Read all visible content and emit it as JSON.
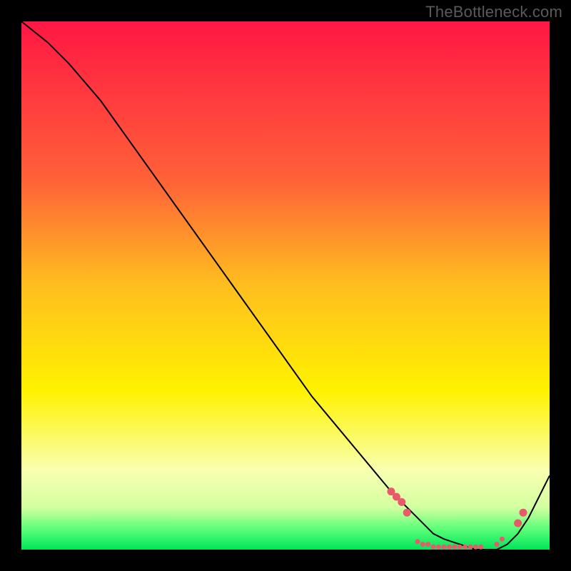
{
  "watermark": "TheBottleneck.com",
  "chart_data": {
    "type": "line",
    "title": "",
    "xlabel": "",
    "ylabel": "",
    "xlim": [
      0,
      100
    ],
    "ylim": [
      0,
      100
    ],
    "grid": false,
    "legend": false,
    "background_gradient_stops": [
      {
        "offset": 0,
        "color": "#ff1744"
      },
      {
        "offset": 30,
        "color": "#ff6138"
      },
      {
        "offset": 50,
        "color": "#ffbe1f"
      },
      {
        "offset": 70,
        "color": "#fff200"
      },
      {
        "offset": 85,
        "color": "#f9ffb0"
      },
      {
        "offset": 92,
        "color": "#d3ffa0"
      },
      {
        "offset": 96,
        "color": "#5eff7a"
      },
      {
        "offset": 100,
        "color": "#00e55a"
      }
    ],
    "series": [
      {
        "name": "curve",
        "stroke": "#000000",
        "x": [
          0,
          5,
          9,
          15,
          20,
          25,
          30,
          35,
          40,
          45,
          50,
          55,
          60,
          65,
          70,
          72,
          75,
          78,
          80,
          83,
          86,
          88,
          90,
          92,
          94,
          96,
          98,
          100
        ],
        "y": [
          100,
          96,
          92,
          85,
          78,
          71,
          64,
          57,
          50,
          43,
          36,
          29,
          23,
          17,
          11,
          9,
          6,
          3,
          2,
          1,
          0,
          0,
          0,
          1,
          3,
          6,
          10,
          14
        ]
      }
    ],
    "markers": {
      "color": "#e85a6a",
      "radius_large": 5.5,
      "radius_small": 3.5,
      "points": [
        {
          "x": 70,
          "y": 11,
          "r": "large"
        },
        {
          "x": 71,
          "y": 10,
          "r": "large"
        },
        {
          "x": 72,
          "y": 9,
          "r": "large"
        },
        {
          "x": 73,
          "y": 7,
          "r": "large"
        },
        {
          "x": 75,
          "y": 1.5,
          "r": "small"
        },
        {
          "x": 76,
          "y": 1,
          "r": "small"
        },
        {
          "x": 77,
          "y": 1,
          "r": "small"
        },
        {
          "x": 78,
          "y": 0.5,
          "r": "small"
        },
        {
          "x": 79,
          "y": 0.5,
          "r": "small"
        },
        {
          "x": 80,
          "y": 0.5,
          "r": "small"
        },
        {
          "x": 81,
          "y": 0.5,
          "r": "small"
        },
        {
          "x": 82,
          "y": 0.5,
          "r": "small"
        },
        {
          "x": 83,
          "y": 0.5,
          "r": "small"
        },
        {
          "x": 84,
          "y": 0.5,
          "r": "small"
        },
        {
          "x": 85,
          "y": 0.5,
          "r": "small"
        },
        {
          "x": 86,
          "y": 0.5,
          "r": "small"
        },
        {
          "x": 87,
          "y": 0.5,
          "r": "small"
        },
        {
          "x": 90,
          "y": 1,
          "r": "small"
        },
        {
          "x": 91,
          "y": 2,
          "r": "small"
        },
        {
          "x": 94,
          "y": 5,
          "r": "large"
        },
        {
          "x": 95,
          "y": 7,
          "r": "large"
        }
      ]
    }
  }
}
